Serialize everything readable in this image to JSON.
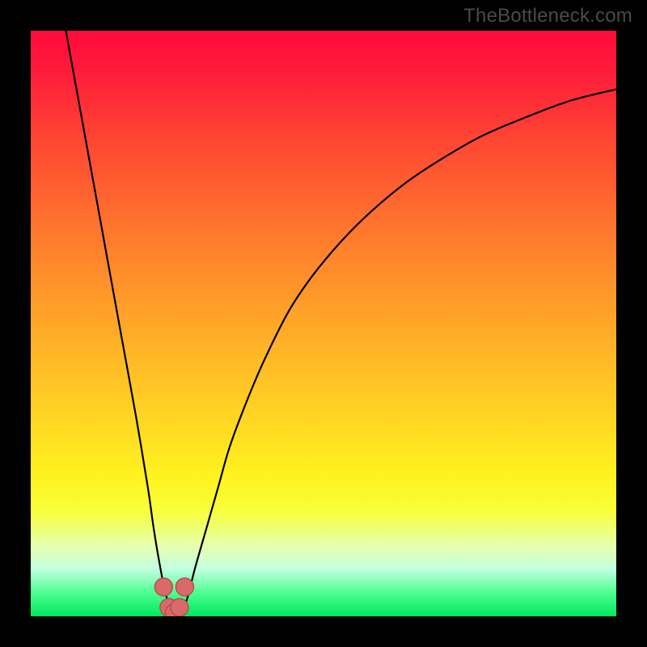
{
  "watermark": "TheBottleneck.com",
  "colors": {
    "frame": "#000000",
    "curve_stroke": "#000000",
    "marker_fill": "#d96a6a",
    "marker_stroke": "#b54f4f",
    "gradient_top": "#ff0a3c",
    "gradient_bottom": "#00e85e"
  },
  "chart_data": {
    "type": "line",
    "title": "",
    "xlabel": "",
    "ylabel": "",
    "xlim": [
      0,
      100
    ],
    "ylim": [
      0,
      100
    ],
    "grid": false,
    "legend": false,
    "annotations": [],
    "series": [
      {
        "name": "curve",
        "x": [
          6,
          8,
          10,
          12,
          14,
          16,
          18,
          20,
          21,
          22,
          23,
          24,
          25,
          26,
          27,
          28,
          30,
          32,
          34,
          37,
          40,
          44,
          48,
          53,
          58,
          64,
          70,
          77,
          84,
          92,
          100
        ],
        "y": [
          100,
          89,
          78,
          67,
          56,
          45,
          34,
          22,
          15,
          9,
          4,
          1,
          0,
          1,
          4,
          8,
          15,
          22,
          29,
          37,
          44,
          52,
          58,
          64,
          69,
          74,
          78,
          82,
          85,
          88,
          90
        ]
      }
    ],
    "markers": {
      "name": "highlight",
      "x": [
        22.7,
        23.6,
        24.5,
        25.4,
        26.3
      ],
      "y": [
        5,
        1.5,
        0.6,
        1.5,
        5
      ]
    }
  }
}
